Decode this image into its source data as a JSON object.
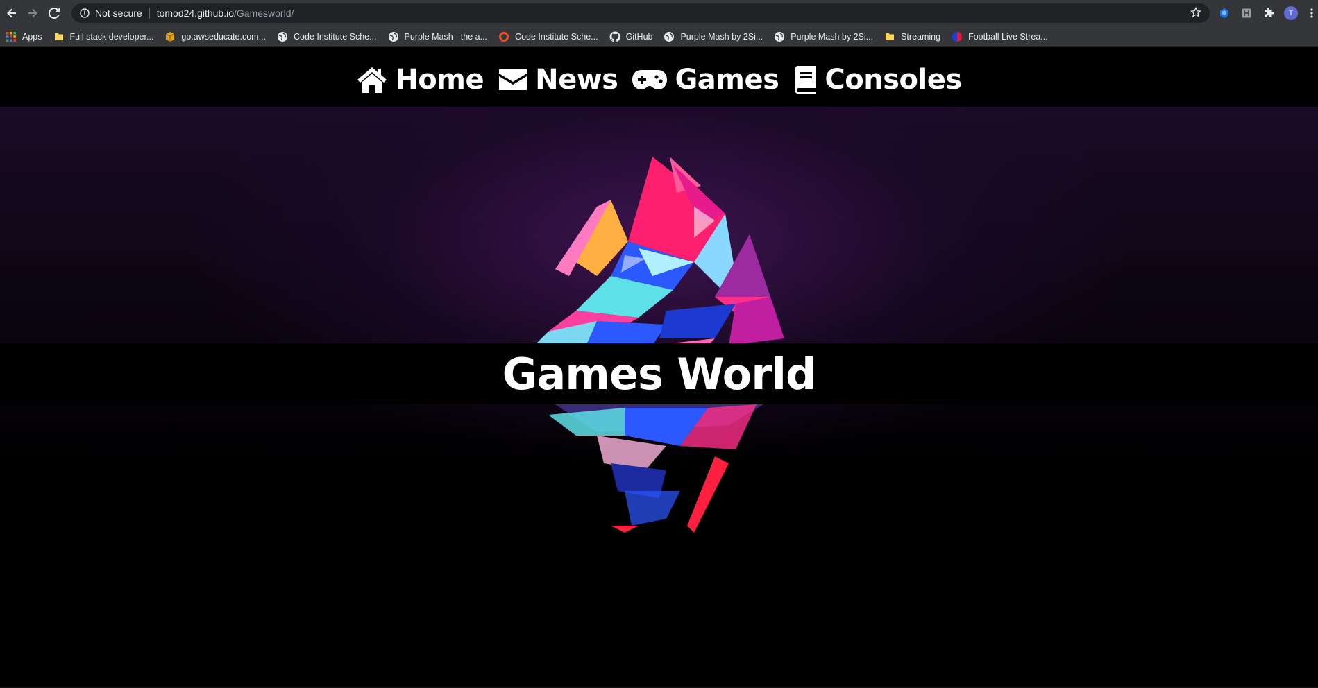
{
  "browser": {
    "security_label": "Not secure",
    "url_host": "tomod24.github.io",
    "url_path": "/Gamesworld/",
    "profile_initial": "T",
    "bookmarks": [
      {
        "label": "Apps",
        "icon": "apps-grid-icon"
      },
      {
        "label": "Full stack developer...",
        "icon": "folder-icon"
      },
      {
        "label": "go.awseducate.com...",
        "icon": "box-icon"
      },
      {
        "label": "Code Institute Sche...",
        "icon": "globe-icon"
      },
      {
        "label": "Purple Mash - the a...",
        "icon": "globe-icon"
      },
      {
        "label": "Code Institute Sche...",
        "icon": "ring-icon"
      },
      {
        "label": "GitHub",
        "icon": "github-icon"
      },
      {
        "label": "Purple Mash by 2Si...",
        "icon": "globe-icon"
      },
      {
        "label": "Purple Mash by 2Si...",
        "icon": "globe-icon"
      },
      {
        "label": "Streaming",
        "icon": "folder-icon"
      },
      {
        "label": "Football Live Strea...",
        "icon": "circle-icon"
      }
    ]
  },
  "nav": {
    "home": "Home",
    "news": "News",
    "games": "Games",
    "consoles": "Consoles"
  },
  "hero": {
    "title": "Games World"
  },
  "colors": {
    "accent_pink": "#ff1f6f",
    "accent_blue": "#2c58ff",
    "accent_cyan": "#5ee0e8",
    "background_purple": "#2a0d3a"
  }
}
